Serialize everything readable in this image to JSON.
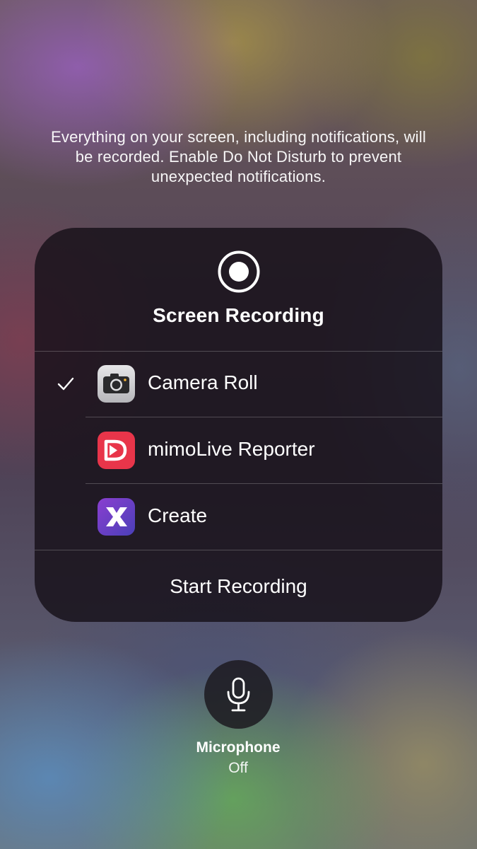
{
  "notice": {
    "text": "Everything on your screen, including notifications, will be recorded. Enable Do Not Disturb to prevent unexpected notifications."
  },
  "panel": {
    "title": "Screen Recording",
    "icon": "record-icon",
    "destinations": [
      {
        "label": "Camera Roll",
        "icon": "camera-icon",
        "selected": true
      },
      {
        "label": "mimoLive Reporter",
        "icon": "mimolive-icon",
        "selected": false
      },
      {
        "label": "Create",
        "icon": "create-app-icon",
        "selected": false
      }
    ],
    "start_label": "Start Recording"
  },
  "microphone": {
    "label": "Microphone",
    "state": "Off",
    "icon": "microphone-icon"
  },
  "colors": {
    "panel_background": "#161018",
    "mimolive_red": "#e8354a",
    "create_purple": "#6a3fc4"
  }
}
